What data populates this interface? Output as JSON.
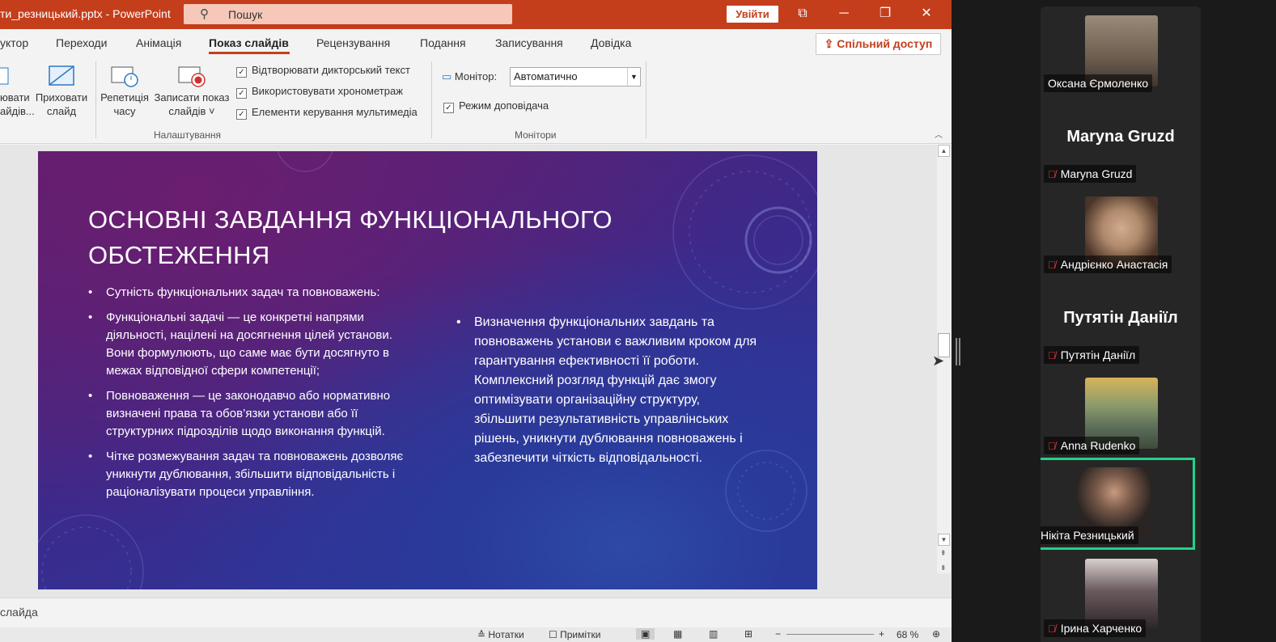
{
  "window": {
    "title": "ти_резницький.pptx - PowerPoint",
    "search_placeholder": "Пошук",
    "signin_label": "Увійти",
    "share_label": "Спільний доступ"
  },
  "tabs": [
    {
      "label": "уктор"
    },
    {
      "label": "Переходи"
    },
    {
      "label": "Анімація"
    },
    {
      "label": "Показ слайдів",
      "active": true
    },
    {
      "label": "Рецензування"
    },
    {
      "label": "Подання"
    },
    {
      "label": "Записування"
    },
    {
      "label": "Довідка"
    }
  ],
  "ribbon": {
    "btn_hide_partial": "ювати\nайдів...",
    "btn_hide_slide": "Приховати\nслайд",
    "btn_rehearse": "Репетиція\nчасу",
    "btn_record": "Записати показ\nслайдів ˅",
    "check_narration": "Відтворювати дикторський текст",
    "check_timings": "Використовувати хронометраж",
    "check_media": "Елементи керування мультимедіа",
    "group_setup": "Налаштування",
    "monitor_label": "Монітор:",
    "monitor_value": "Автоматично",
    "check_presenter": "Режим доповідача",
    "group_monitors": "Монітори"
  },
  "slide": {
    "title": "Основні завдання функціонального обстеження",
    "left_bullets": [
      "Сутність функціональних задач та повноважень:",
      "Функціональні задачі — це конкретні напрями діяльності, націлені на досягнення цілей установи. Вони формулюють, що саме має бути досягнуто в межах відповідної сфери компетенції;",
      "Повноваження — це законодавчо або нормативно визначені права та обов’язки установи або її структурних підрозділів щодо виконання функцій.",
      "Чітке розмежування задач та повноважень дозволяє уникнути дублювання, збільшити відповідальність і раціоналізувати процеси управління."
    ],
    "right_bullets": [
      "Визначення функціональних завдань та повноважень установи є важливим кроком для гарантування ефективності її роботи. Комплексний розгляд функцій дає змогу оптимізувати організаційну структуру, збільшити результативність управлінських рішень, уникнути дублювання повноважень і забезпечити чіткість відповідальності."
    ]
  },
  "notes_label": "слайда",
  "status": {
    "notes": "Нотатки",
    "comments": "Примітки",
    "zoom": "68 %"
  },
  "participants": [
    {
      "name": "Оксана Єрмоленко",
      "has_video": true,
      "muted": false,
      "photo": "#7a6b5d"
    },
    {
      "name": "Maryna Gruzd",
      "has_video": false,
      "muted": true,
      "display": "Maryna Gruzd"
    },
    {
      "name": "Андрієнко Анастасія",
      "has_video": true,
      "muted": true,
      "photo": "#b08a6c"
    },
    {
      "name": "Путятін Даніїл",
      "has_video": false,
      "muted": true,
      "display": "Путятін Даніїл"
    },
    {
      "name": "Anna Rudenko",
      "has_video": true,
      "muted": true,
      "photo": "#8a9a6a"
    },
    {
      "name": "Нікіта Резницький",
      "has_video": true,
      "muted": false,
      "speaking": true,
      "photo": "#4a3a33"
    },
    {
      "name": "Ірина Харченко",
      "has_video": true,
      "muted": true,
      "photo": "#5a4a4e"
    }
  ],
  "colors": {
    "accent": "#c43e1c",
    "speaking_border": "#23d18b",
    "muted_icon": "#e0383e"
  }
}
